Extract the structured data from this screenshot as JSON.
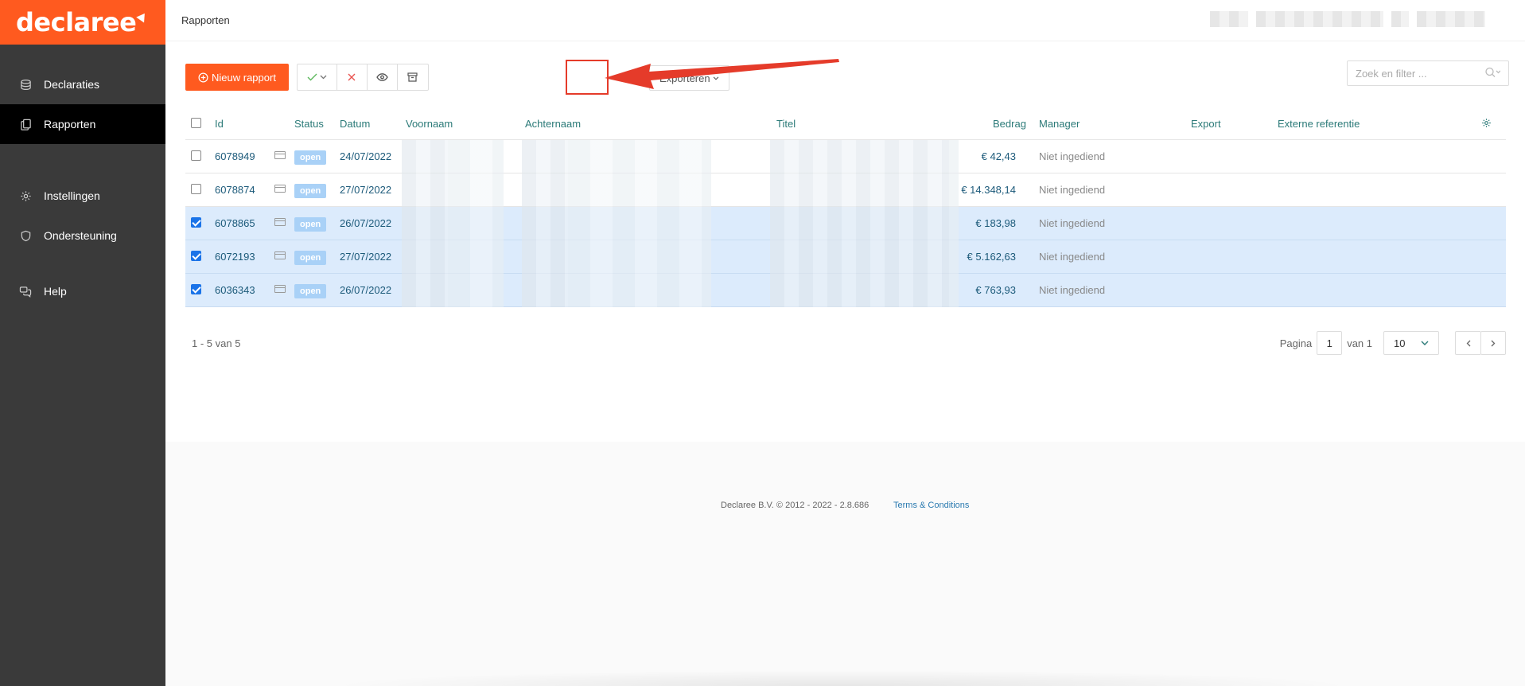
{
  "brand": {
    "name": "declaree",
    "accent": "#ff5a1f"
  },
  "sidebar": {
    "items": [
      {
        "label": "Declaraties",
        "icon": "stack-icon"
      },
      {
        "label": "Rapporten",
        "icon": "documents-icon",
        "active": true
      },
      {
        "label": "Instellingen",
        "icon": "gear-icon"
      },
      {
        "label": "Ondersteuning",
        "icon": "shield-icon"
      },
      {
        "label": "Help",
        "icon": "chat-icon"
      }
    ]
  },
  "header": {
    "title": "Rapporten"
  },
  "toolbar": {
    "new_report": "Nieuw rapport",
    "export": "Exporteren"
  },
  "search": {
    "placeholder": "Zoek en filter ..."
  },
  "table": {
    "columns": [
      "Id",
      "Status",
      "Datum",
      "Voornaam",
      "Achternaam",
      "Titel",
      "Bedrag",
      "Manager",
      "Export",
      "Externe referentie"
    ],
    "rows": [
      {
        "id": "6078949",
        "status": "open",
        "date": "24/07/2022",
        "amount": "€ 42,43",
        "manager": "Niet ingediend",
        "checked": false
      },
      {
        "id": "6078874",
        "status": "open",
        "date": "27/07/2022",
        "amount": "€ 14.348,14",
        "manager": "Niet ingediend",
        "checked": false
      },
      {
        "id": "6078865",
        "status": "open",
        "date": "26/07/2022",
        "amount": "€ 183,98",
        "manager": "Niet ingediend",
        "checked": true
      },
      {
        "id": "6072193",
        "status": "open",
        "date": "27/07/2022",
        "amount": "€ 5.162,63",
        "manager": "Niet ingediend",
        "checked": true
      },
      {
        "id": "6036343",
        "status": "open",
        "date": "26/07/2022",
        "amount": "€ 763,93",
        "manager": "Niet ingediend",
        "checked": true
      }
    ]
  },
  "pagination": {
    "summary": "1 - 5 van 5",
    "page_label": "Pagina",
    "page": "1",
    "of_label": "van 1",
    "per_page": "10"
  },
  "footer": {
    "copyright": "Declaree B.V. © 2012 - 2022 - 2.8.686",
    "terms": "Terms & Conditions"
  }
}
